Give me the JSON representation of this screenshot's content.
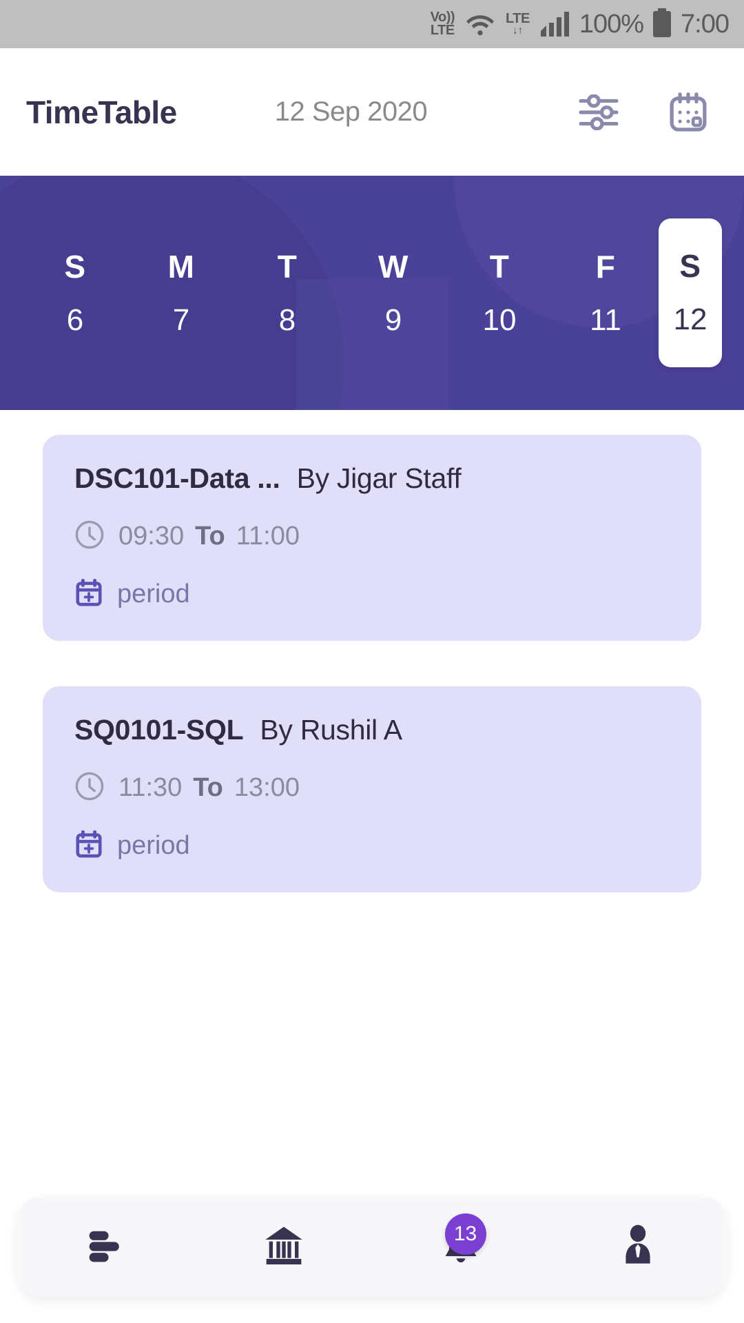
{
  "status_bar": {
    "volte_line1": "Vo))",
    "volte_line2": "LTE",
    "wifi_icon": "wifi-icon",
    "lte_label": "LTE",
    "signal_icon": "signal-bars-icon",
    "battery_percent": "100%",
    "battery_icon": "battery-icon",
    "time": "7:00"
  },
  "header": {
    "title": "TimeTable",
    "date": "12 Sep 2020",
    "filter_icon": "sliders-filter-icon",
    "calendar_icon": "calendar-icon"
  },
  "week": {
    "accent_color": "#4a4199",
    "selected_index": 6,
    "days": [
      {
        "dow": "S",
        "date": "6"
      },
      {
        "dow": "M",
        "date": "7"
      },
      {
        "dow": "T",
        "date": "8"
      },
      {
        "dow": "W",
        "date": "9"
      },
      {
        "dow": "T",
        "date": "10"
      },
      {
        "dow": "F",
        "date": "11"
      },
      {
        "dow": "S",
        "date": "12"
      }
    ]
  },
  "schedule": {
    "card_color": "#e0def9",
    "classes": [
      {
        "code": "DSC101-Data ...",
        "by": "By Jigar Staff",
        "start": "09:30",
        "to_label": "To",
        "end": "11:00",
        "type": "period",
        "clock_icon": "clock-icon",
        "period_icon": "calendar-plus-icon"
      },
      {
        "code": "SQ0101-SQL",
        "by": "By Rushil A",
        "start": "11:30",
        "to_label": "To",
        "end": "13:00",
        "type": "period",
        "clock_icon": "clock-icon",
        "period_icon": "calendar-plus-icon"
      }
    ]
  },
  "bottom_nav": {
    "badge_color": "#7b3fd1",
    "items": [
      {
        "icon": "menu-list-icon",
        "badge": null
      },
      {
        "icon": "bank-institution-icon",
        "badge": null
      },
      {
        "icon": "bell-notification-icon",
        "badge": "13"
      },
      {
        "icon": "person-profile-icon",
        "badge": null
      }
    ]
  }
}
